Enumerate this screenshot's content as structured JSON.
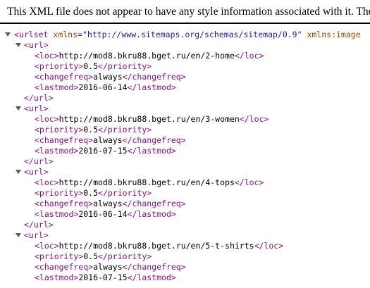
{
  "header": {
    "notice": "This XML file does not appear to have any style information associated with it. The document tree is shown below."
  },
  "root": {
    "open_tag": "<urlset",
    "attr_name": "xmlns",
    "attr_eq": "=",
    "attr_value": "\"http://www.sitemaps.org/schemas/sitemap/0.9\"",
    "attr2_name": "xmlns:image",
    "open_tag_end": ">"
  },
  "tags": {
    "url_open": "<url>",
    "url_close": "</url>",
    "loc_open": "<loc>",
    "loc_close": "</loc>",
    "priority_open": "<priority>",
    "priority_close": "</priority>",
    "changefreq_open": "<changefreq>",
    "changefreq_close": "</changefreq>",
    "lastmod_open": "<lastmod>",
    "lastmod_close": "</lastmod>"
  },
  "urls": [
    {
      "loc": "http://mod8.bkru88.bget.ru/en/2-home",
      "priority": "0.5",
      "changefreq": "always",
      "lastmod": "2016-06-14"
    },
    {
      "loc": "http://mod8.bkru88.bget.ru/en/3-women",
      "priority": "0.5",
      "changefreq": "always",
      "lastmod": "2016-07-15"
    },
    {
      "loc": "http://mod8.bkru88.bget.ru/en/4-tops",
      "priority": "0.5",
      "changefreq": "always",
      "lastmod": "2016-06-14"
    },
    {
      "loc": "http://mod8.bkru88.bget.ru/en/5-t-shirts",
      "priority": "0.5",
      "changefreq": "always",
      "lastmod": "2016-07-15"
    }
  ],
  "colors": {
    "tag": "#881280",
    "attr_name": "#994500",
    "attr_value": "#1a1aa6",
    "toggle": "#5a5a5a"
  }
}
